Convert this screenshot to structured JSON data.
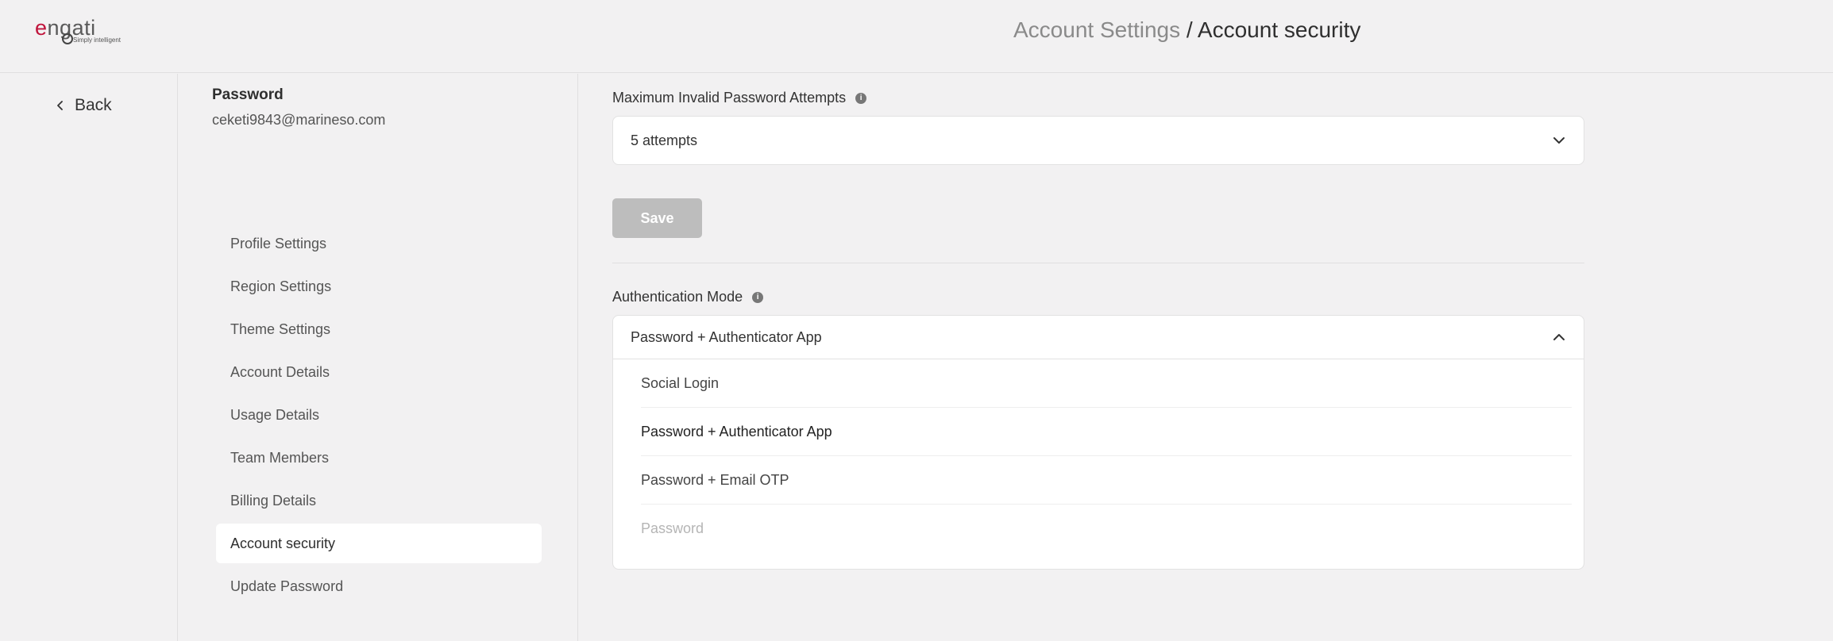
{
  "logo": {
    "word": "ngati",
    "e": "e",
    "tagline": "Simply intelligent"
  },
  "breadcrumb": {
    "parent": "Account Settings",
    "separator": " / ",
    "current": "Account security"
  },
  "back": {
    "label": "Back"
  },
  "account": {
    "title": "Password",
    "email": "ceketi9843@marineso.com"
  },
  "nav": {
    "items": [
      {
        "label": "Profile Settings"
      },
      {
        "label": "Region Settings"
      },
      {
        "label": "Theme Settings"
      },
      {
        "label": "Account Details"
      },
      {
        "label": "Usage Details"
      },
      {
        "label": "Team Members"
      },
      {
        "label": "Billing Details"
      },
      {
        "label": "Account security",
        "active": true
      },
      {
        "label": "Update Password"
      }
    ]
  },
  "max_attempts": {
    "label": "Maximum Invalid Password Attempts",
    "value": "5 attempts",
    "info_icon": "info-icon"
  },
  "save": {
    "label": "Save"
  },
  "auth_mode": {
    "label": "Authentication Mode",
    "value": "Password + Authenticator App",
    "options": [
      {
        "label": "Social Login",
        "state": "normal"
      },
      {
        "label": "Password + Authenticator App",
        "state": "selected"
      },
      {
        "label": "Password + Email OTP",
        "state": "normal"
      },
      {
        "label": "Password",
        "state": "disabled"
      }
    ]
  },
  "colors": {
    "background": "#f2f1f2",
    "logo_accent": "#c0143c",
    "save_disabled": "#bdbdbd",
    "active_nav": "#ffffff"
  }
}
